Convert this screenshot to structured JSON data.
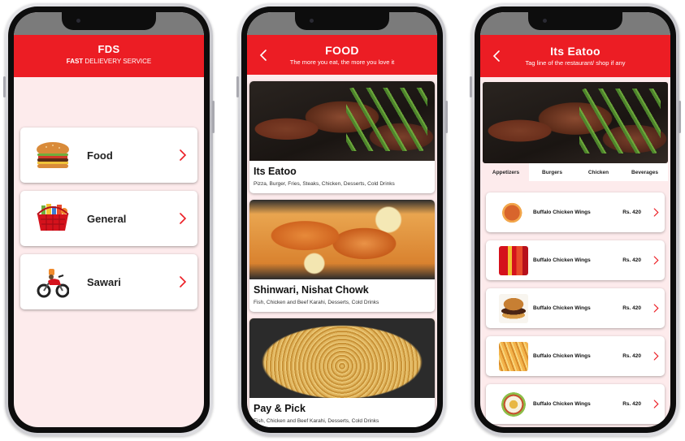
{
  "screen1": {
    "header": {
      "title": "FDS",
      "subtitle_bold": "FAST",
      "subtitle_rest": " DELIEVERY SERVICE"
    },
    "categories": [
      {
        "label": "Food",
        "icon": "burger-icon"
      },
      {
        "label": "General",
        "icon": "grocery-basket-icon"
      },
      {
        "label": "Sawari",
        "icon": "motorbike-icon"
      }
    ]
  },
  "screen2": {
    "header": {
      "title": "FOOD",
      "subtitle": "The more you eat, the more you love it"
    },
    "restaurants": [
      {
        "name": "Its Eatoo",
        "tags": "Pizza, Burger, Fries, Steaks, Chicken, Desserts, Cold Drinks"
      },
      {
        "name": "Shinwari, Nishat Chowk",
        "tags": "Fish, Chicken and Beef Karahi, Desserts, Cold Drinks"
      },
      {
        "name": "Pay & Pick",
        "tags": "Fish, Chicken and Beef Karahi, Desserts, Cold Drinks"
      }
    ]
  },
  "screen3": {
    "header": {
      "title": "Its Eatoo",
      "subtitle": "Tag line of the restaurant/ shop if any"
    },
    "tabs": [
      "Appetizers",
      "Burgers",
      "Chicken",
      "Beverages"
    ],
    "items": [
      {
        "name": "Buffalo Chicken Wings",
        "price": "Rs. 420"
      },
      {
        "name": "Buffalo Chicken Wings",
        "price": "Rs. 420"
      },
      {
        "name": "Buffalo Chicken Wings",
        "price": "Rs. 420"
      },
      {
        "name": "Buffalo Chicken Wings",
        "price": "Rs. 420"
      },
      {
        "name": "Buffalo Chicken Wings",
        "price": "Rs. 420"
      }
    ]
  },
  "colors": {
    "brand_red": "#ec1d24",
    "background_pink": "#fdebec"
  }
}
